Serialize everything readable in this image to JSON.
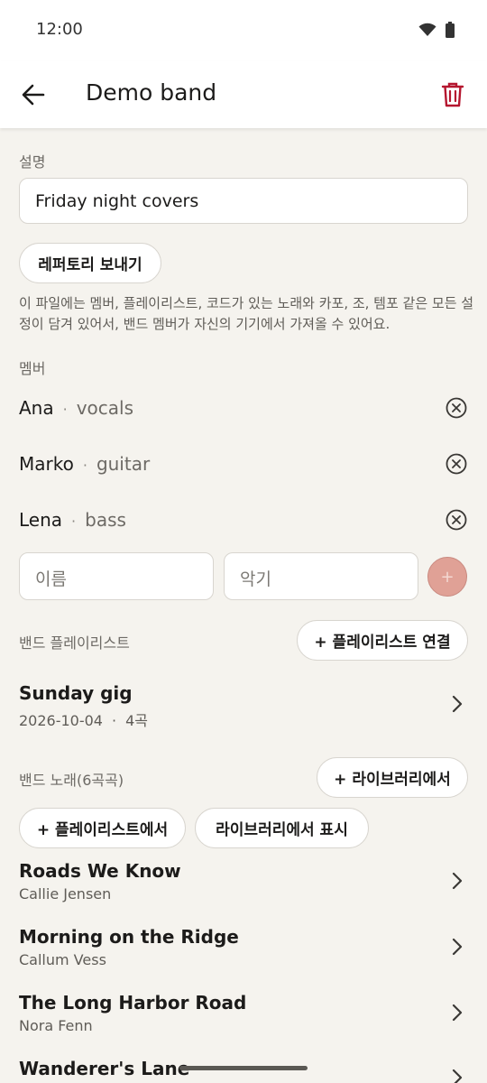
{
  "status": {
    "time": "12:00"
  },
  "header": {
    "title": "Demo band"
  },
  "description": {
    "label": "설명",
    "value": "Friday night covers",
    "export_button": "레퍼토리 보내기",
    "export_note": "이 파일에는 멤버, 플레이리스트, 코드가 있는 노래와 카포, 조, 템포 같은 모든 설정이 담겨 있어서, 밴드 멤버가 자신의 기기에서 가져올 수 있어요."
  },
  "members": {
    "label": "멤버",
    "items": [
      {
        "name": "Ana",
        "instrument": "vocals"
      },
      {
        "name": "Marko",
        "instrument": "guitar"
      },
      {
        "name": "Lena",
        "instrument": "bass"
      }
    ],
    "name_placeholder": "이름",
    "instrument_placeholder": "악기",
    "separator": "·",
    "add_symbol": "+"
  },
  "playlists": {
    "label": "밴드 플레이리스트",
    "link_button": "+ 플레이리스트 연결",
    "items": [
      {
        "title": "Sunday gig",
        "date": "2026-10-04",
        "count": "4곡"
      }
    ]
  },
  "songs": {
    "label": "밴드 노래(6곡곡)",
    "from_library_button": "+ 라이브러리에서",
    "from_playlist_button": "+ 플레이리스트에서",
    "show_in_library_button": "라이브러리에서 표시",
    "items": [
      {
        "title": "Roads We Know",
        "artist": "Callie Jensen"
      },
      {
        "title": "Morning on the Ridge",
        "artist": "Callum Vess"
      },
      {
        "title": "The Long Harbor Road",
        "artist": "Nora Fenn"
      },
      {
        "title": "Wanderer's Lane",
        "artist": ""
      }
    ]
  },
  "colors": {
    "accent": "#b5162f",
    "add_button": "#e0a196",
    "background": "#f5f3ee"
  }
}
